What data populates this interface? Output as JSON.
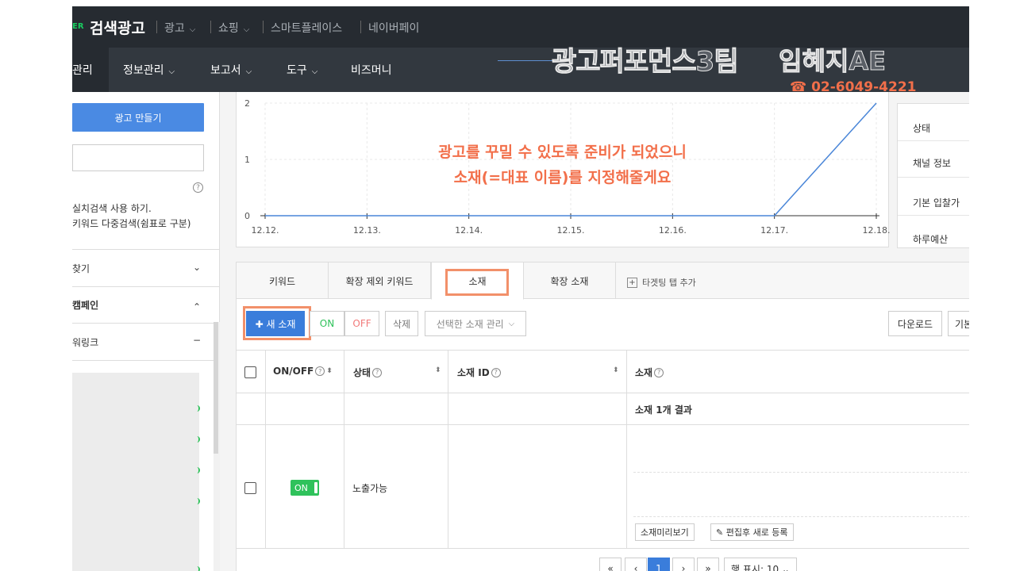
{
  "header": {
    "brand_prefix": "ER",
    "brand": "검색광고",
    "top_menu": [
      "광고",
      "쇼핑",
      "스마트플레이스",
      "네이버페이"
    ],
    "nav": [
      "관리",
      "정보관리",
      "보고서",
      "도구",
      "비즈머니"
    ]
  },
  "overlay": {
    "team": "광고퍼포먼스3팀",
    "name": "임혜지AE",
    "phone": "☎ 02-6049-4221",
    "note_line1": "광고를 꾸밀 수 있도록 준비가 되었으니",
    "note_line2": "소재(=대표 이름)를 지정해줄게요"
  },
  "sidebar": {
    "create_button": "광고 만들기",
    "help": "?",
    "hint_line1": "실치검색 사용 하기.",
    "hint_line2": "키워드 다중검색(쉼표로 구분)",
    "find": "찾기",
    "campaign": "캠페인",
    "powerlink": "워링크",
    "chevron_down": "⌄",
    "chevron_up": "⌃",
    "minus": "−"
  },
  "chart_data": {
    "type": "line",
    "x": [
      "12.12.",
      "12.13.",
      "12.14.",
      "12.15.",
      "12.16.",
      "12.17.",
      "12.18."
    ],
    "series": [
      {
        "values": [
          0,
          0,
          0,
          0,
          0,
          0,
          2
        ]
      }
    ],
    "y_ticks": [
      "0",
      "1",
      "2"
    ],
    "ylim": [
      0,
      2
    ],
    "grid": true,
    "color": "#4a86d8"
  },
  "info_panel": {
    "rows": [
      "상태",
      "채널 정보",
      "기본 입찰가",
      "하루예산"
    ]
  },
  "tabs": {
    "items": [
      "키워드",
      "확장 제외 키워드",
      "소재",
      "확장 소재"
    ],
    "add_label": "타겟팅 탭 추가",
    "plus": "+"
  },
  "toolbar": {
    "new": "✚ 새 소재",
    "on": "ON",
    "off": "OFF",
    "delete": "삭제",
    "manage": "선택한 소재 관리",
    "download": "다운로드",
    "basic": "기본"
  },
  "table": {
    "headers": {
      "onoff": "ON/OFF",
      "status": "상태",
      "id": "소재 ID",
      "ad": "소재"
    },
    "q": "?",
    "sort": "⬍",
    "result_summary": "소재 1개 결과",
    "row": {
      "toggle": "ON",
      "status": "노출가능",
      "preview_button": "소재미리보기",
      "edit_button": "✎ 편집후 새로 등록"
    }
  },
  "pagination": {
    "first": "«",
    "prev": "‹",
    "current": "1",
    "next": "›",
    "last": "»",
    "rows": "행 표시: 10 ⌄"
  }
}
